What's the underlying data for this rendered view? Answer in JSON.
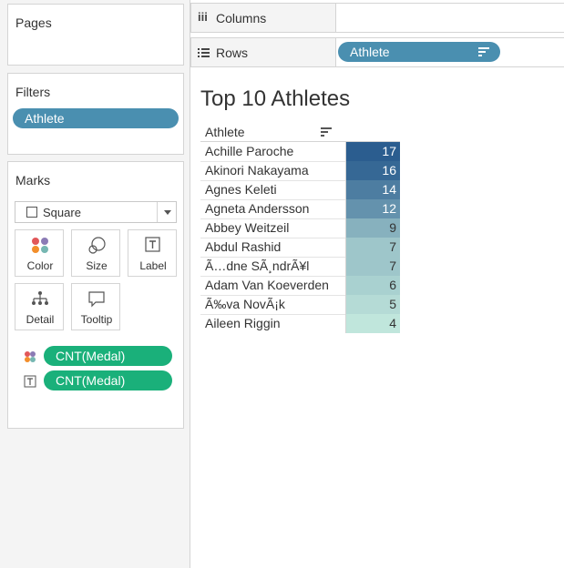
{
  "pages": {
    "title": "Pages"
  },
  "filters": {
    "title": "Filters",
    "pill": "Athlete"
  },
  "marks": {
    "title": "Marks",
    "mark_type": "Square",
    "buttons": {
      "color": "Color",
      "size": "Size",
      "label": "Label",
      "detail": "Detail",
      "tooltip": "Tooltip"
    },
    "fields": [
      {
        "label": "CNT(Medal)",
        "encoding": "color"
      },
      {
        "label": "CNT(Medal)",
        "encoding": "label"
      }
    ]
  },
  "columns_shelf": {
    "icon": "iii",
    "title": "Columns"
  },
  "rows_shelf": {
    "title": "Rows",
    "pill": "Athlete"
  },
  "view": {
    "title": "Top 10 Athletes",
    "column_header": "Athlete"
  },
  "chart_data": {
    "type": "table",
    "title": "Top 10 Athletes",
    "columns": [
      "Athlete",
      "CNT(Medal)"
    ],
    "categories": [
      "Achille Paroche",
      "Akinori Nakayama",
      "Agnes Keleti",
      "Agneta Andersson",
      "Abbey Weitzeil",
      "Abdul Rashid",
      "Ã…dne SÃ¸ndrÃ¥l",
      "Adam Van Koeverden",
      "Ã‰va NovÃ¡k",
      "Aileen Riggin"
    ],
    "values": [
      17,
      16,
      14,
      12,
      9,
      7,
      7,
      6,
      5,
      4
    ],
    "color_range": {
      "min_color": "#c0e6dc",
      "max_color": "#2b5d8f"
    }
  }
}
